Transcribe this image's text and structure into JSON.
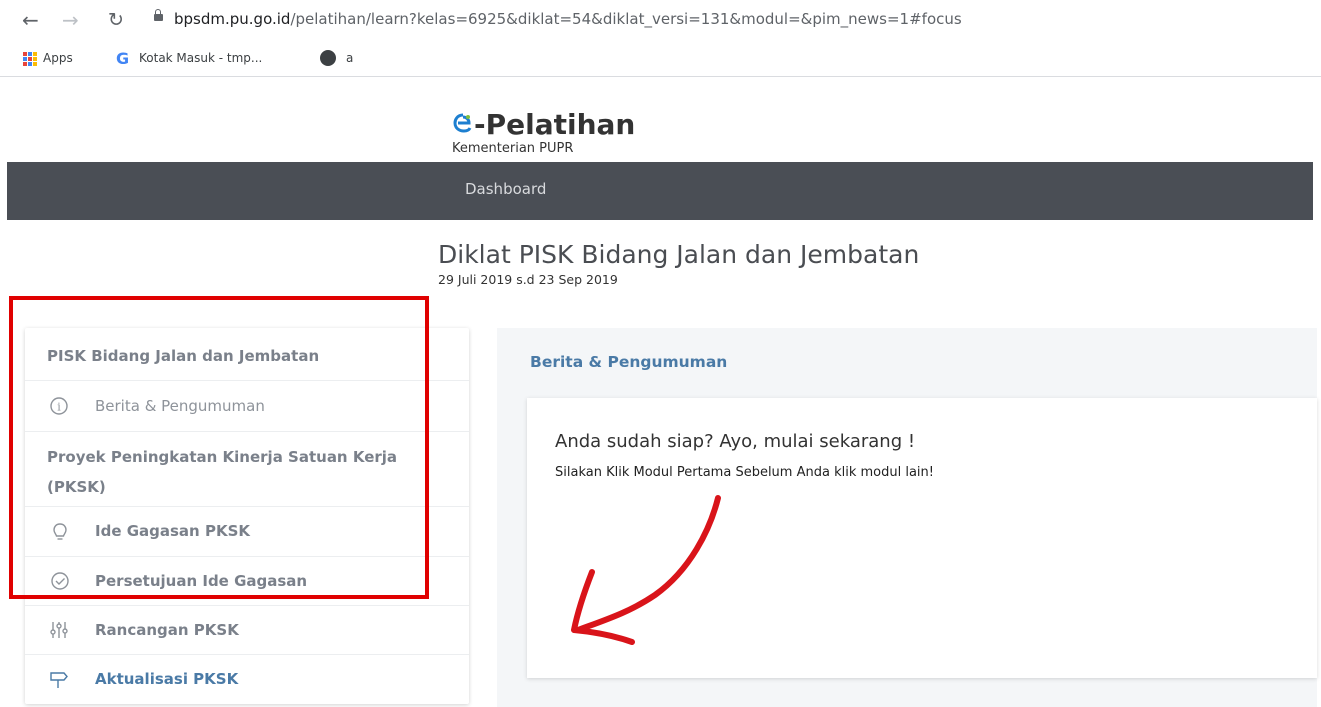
{
  "browser": {
    "url_host": "bpsdm.pu.go.id",
    "url_path": "/pelatihan/learn?kelas=6925&diklat=54&diklat_versi=131&modul=&pim_news=1#focus",
    "bookmarks": [
      "Apps",
      "Kotak Masuk - tmp...",
      "a"
    ]
  },
  "site": {
    "logo_title": "-Pelatihan",
    "logo_subtitle": "Kementerian PUPR",
    "nav": [
      "Dashboard"
    ]
  },
  "course": {
    "title": "Diklat PISK Bidang Jalan dan Jembatan",
    "date_range": "29 Juli 2019 s.d 23 Sep 2019"
  },
  "sidebar": {
    "section1": "PISK Bidang Jalan dan Jembatan",
    "news_item": "Berita & Pengumuman",
    "section2": "Proyek Peningkatan Kinerja Satuan Kerja (PKSK)",
    "items": [
      {
        "label": "Ide Gagasan PKSK",
        "icon": "lightbulb-icon"
      },
      {
        "label": "Persetujuan Ide Gagasan",
        "icon": "check-circle-icon"
      },
      {
        "label": "Rancangan PKSK",
        "icon": "sliders-icon"
      },
      {
        "label": "Aktualisasi PKSK",
        "icon": "signpost-icon"
      }
    ]
  },
  "main": {
    "section_title": "Berita & Pengumuman",
    "card_heading": "Anda sudah siap? Ayo, mulai sekarang !",
    "card_text": "Silakan Klik Modul Pertama Sebelum Anda klik modul lain!"
  },
  "colors": {
    "navbar": "#4a4e55",
    "accent_blue": "#4a7aa6",
    "highlight_red": "#e00000",
    "arrow_red": "#d9141a"
  }
}
